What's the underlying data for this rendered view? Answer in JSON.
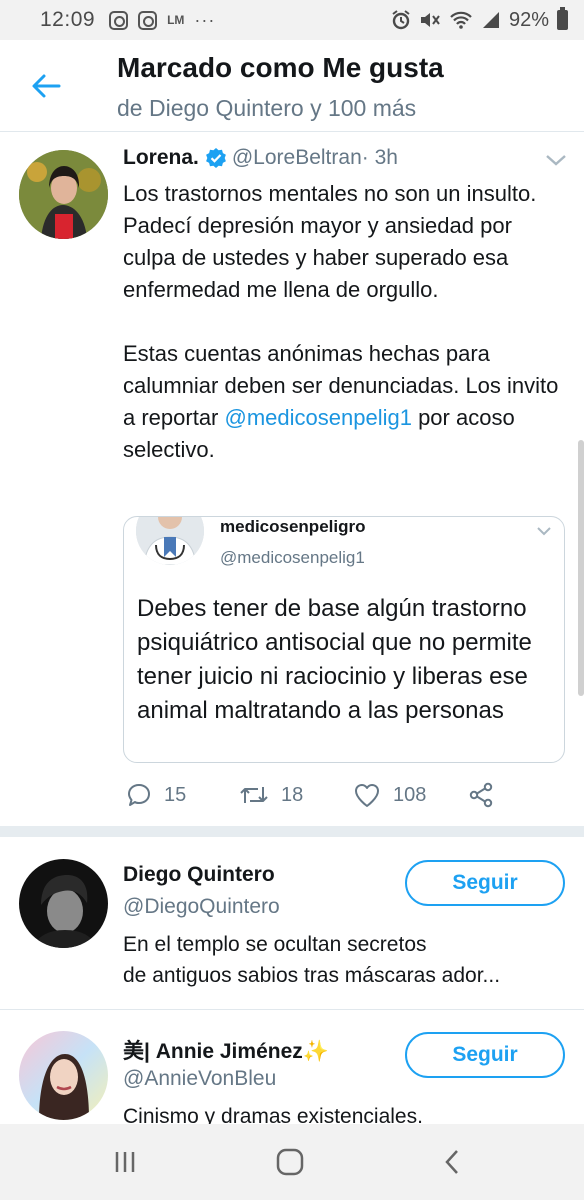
{
  "status_bar": {
    "time": "12:09",
    "left_icons": [
      "instagram-icon",
      "instagram-icon",
      "lm-icon",
      "more-dots-icon"
    ],
    "lm_label": "LM",
    "dots_label": "···",
    "battery": "92%",
    "right_icons": [
      "alarm-icon",
      "mute-icon",
      "wifi-icon",
      "signal-icon",
      "battery-icon"
    ]
  },
  "header": {
    "title": "Marcado como Me gusta",
    "subtitle": "de Diego Quintero y 100 más"
  },
  "tweet": {
    "name": "Lorena.",
    "verified": true,
    "handle": "@LoreBeltran",
    "time": " · 3h",
    "paragraph1": "Los trastornos mentales no son un insulto. Padecí depresión mayor y ansiedad por culpa de ustedes y haber superado esa enfermedad me llena de orgullo.",
    "paragraph2_before": "Estas cuentas anónimas hechas para calumniar deben ser denunciadas. Los invito a reportar ",
    "paragraph2_mention": "@medicosenpelig1",
    "paragraph2_after": " por acoso selectivo.",
    "quote": {
      "name": "medicosenpeligro",
      "handle": "@medicosenpelig1",
      "text": "Debes tener de base algún trastorno psiquiátrico antisocial que no permite tener juicio ni raciocinio y liberas ese animal maltratando a las personas"
    },
    "actions": {
      "replies": "15",
      "retweets": "18",
      "likes": "108"
    }
  },
  "users": [
    {
      "name": "Diego Quintero",
      "handle": "@DiegoQuintero",
      "bio_line1": "En el templo se ocultan secretos",
      "bio_line2": "de antiguos sabios tras máscaras ador...",
      "follow_label": "Seguir"
    },
    {
      "name": "美| Annie Jiménez✨",
      "handle": "@AnnieVonBleu",
      "bio_line1": "Cinismo y dramas existenciales.",
      "follow_label": "Seguir"
    }
  ],
  "colors": {
    "accent": "#1da1f2",
    "link": "#1b95e0",
    "text": "#14171a",
    "secondary": "#657786",
    "separator": "#e6ecf0"
  }
}
